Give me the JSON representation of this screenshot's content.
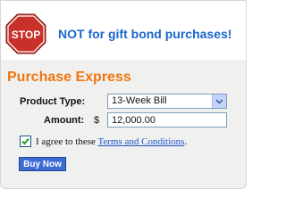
{
  "banner": {
    "stop_sign_text": "STOP",
    "warning_text": "NOT for gift bond purchases!"
  },
  "section": {
    "title": "Purchase Express"
  },
  "form": {
    "product_type_label": "Product Type:",
    "product_type_value": "13-Week Bill",
    "amount_label": "Amount:",
    "currency_symbol": "$",
    "amount_value": "12,000.00",
    "agree_checked": true,
    "agree_prefix": "I agree to these ",
    "terms_link": "Terms and Conditions",
    "agree_suffix": "."
  },
  "actions": {
    "buy_label": "Buy Now"
  },
  "icons": {
    "stop_sign": "stop-sign-icon",
    "dropdown": "chevron-down-icon",
    "checkbox": "check-icon"
  },
  "colors": {
    "warning_blue": "#1a66cc",
    "section_orange": "#ee7711",
    "stop_red": "#c8302a",
    "button_blue": "#3c6bd2"
  }
}
